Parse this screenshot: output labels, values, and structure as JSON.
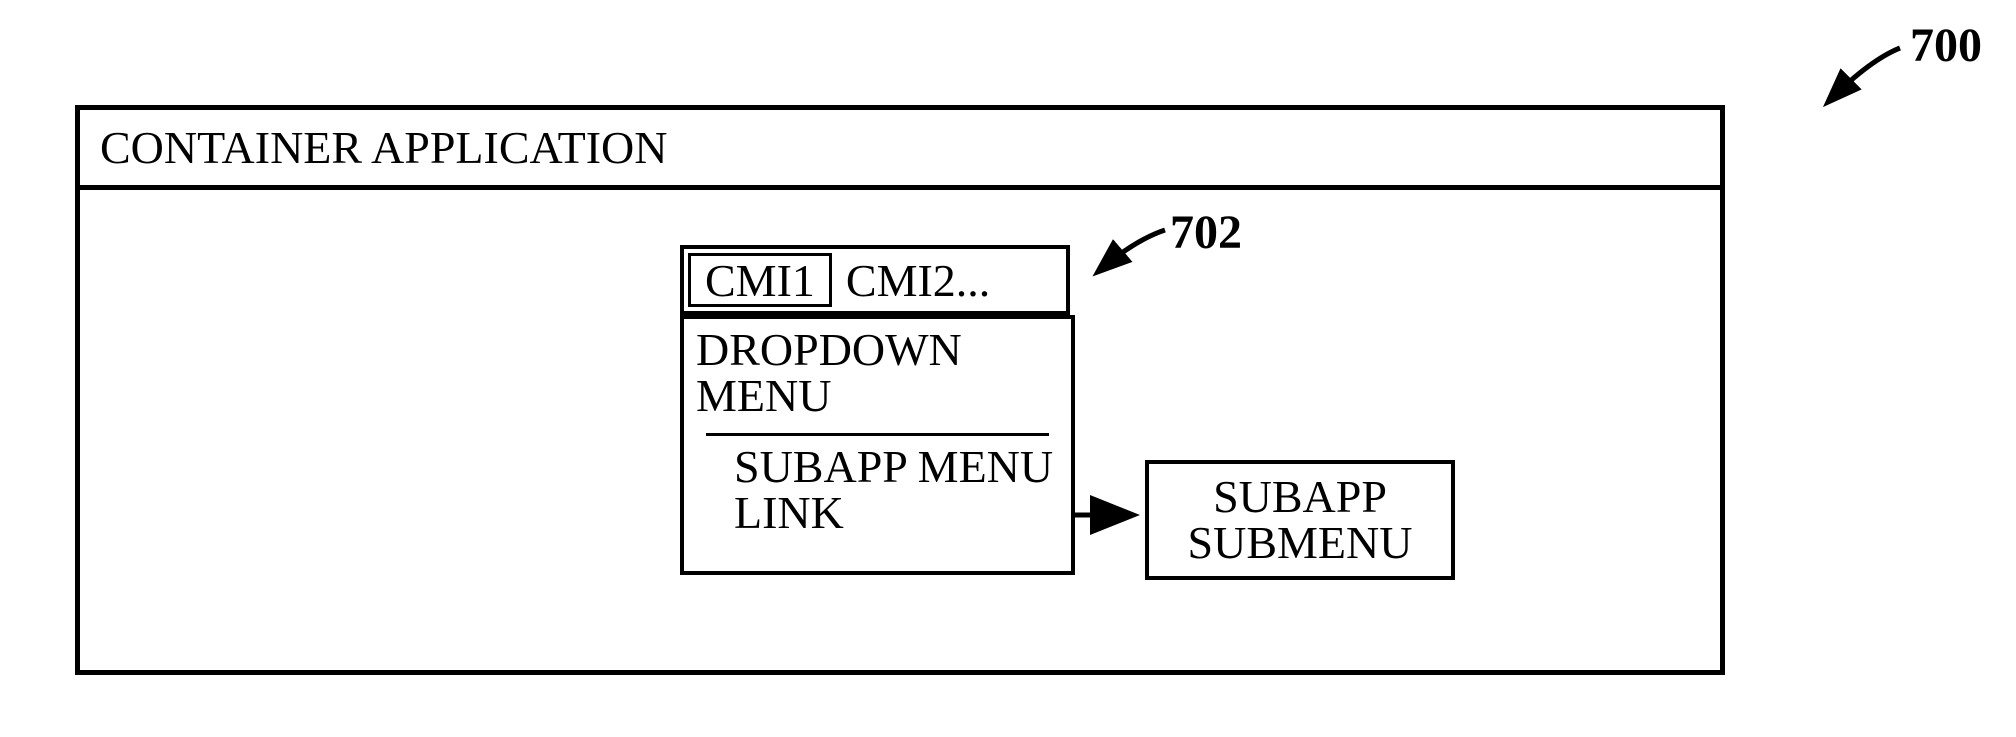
{
  "callouts": {
    "top": "700",
    "inner": "702"
  },
  "window": {
    "title": "CONTAINER APPLICATION"
  },
  "menuBar": {
    "items": [
      "CMI1",
      "CMI2..."
    ]
  },
  "dropdown": {
    "header": "DROPDOWN MENU",
    "linkLabel": "SUBAPP MENU LINK"
  },
  "submenu": {
    "label": "SUBAPP SUBMENU"
  }
}
